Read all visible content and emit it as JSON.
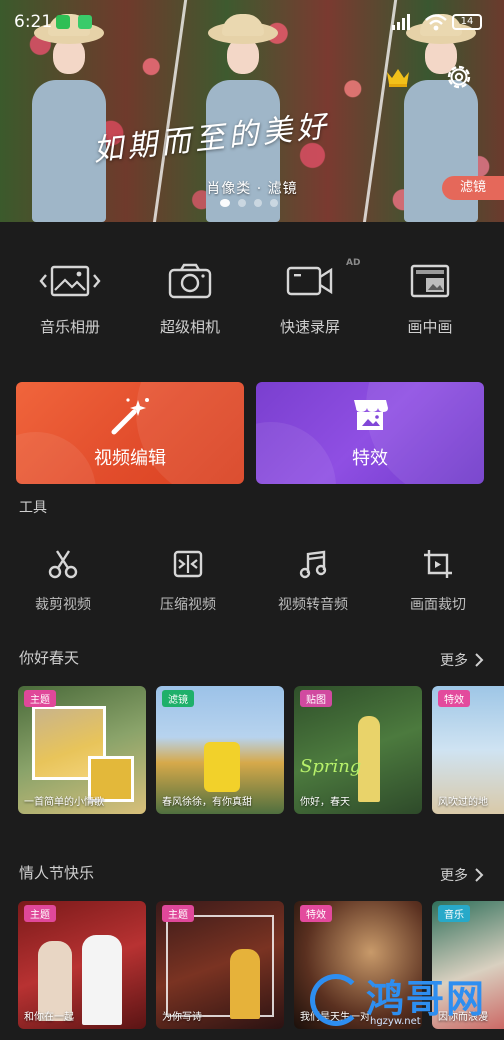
{
  "status": {
    "time": "6:21",
    "battery": "14"
  },
  "banner": {
    "title": "如期而至的美好",
    "subtitle": "肖像类 · 滤镜",
    "tag": "滤镜",
    "page_count": 4,
    "active_page": 1
  },
  "quick_tools": [
    {
      "label": "音乐相册",
      "icon": "photo-album-icon"
    },
    {
      "label": "超级相机",
      "icon": "camera-icon"
    },
    {
      "label": "快速录屏",
      "icon": "screen-record-icon"
    },
    {
      "label": "画中画",
      "icon": "picture-in-picture-icon"
    }
  ],
  "ad_badge": "AD",
  "cards": {
    "edit": {
      "label": "视频编辑",
      "icon": "magic-wand-icon",
      "color": "#e85530"
    },
    "fx": {
      "label": "特效",
      "icon": "store-icon",
      "color": "#8147d8"
    }
  },
  "tools_title": "工具",
  "tools": [
    {
      "label": "裁剪视频",
      "icon": "scissors-icon"
    },
    {
      "label": "压缩视频",
      "icon": "compress-icon"
    },
    {
      "label": "视频转音频",
      "icon": "music-note-icon"
    },
    {
      "label": "画面裁切",
      "icon": "crop-icon"
    }
  ],
  "sections": [
    {
      "title": "你好春天",
      "more": "更多",
      "items": [
        {
          "tag": "主题",
          "tag_type": "theme",
          "caption": "一首简单的小情歌"
        },
        {
          "tag": "滤镜",
          "tag_type": "filter",
          "caption": "春风徐徐，有你真甜"
        },
        {
          "tag": "贴图",
          "tag_type": "sticker",
          "caption": "你好，春天"
        },
        {
          "tag": "特效",
          "tag_type": "effect",
          "caption": "风吹过的地"
        }
      ]
    },
    {
      "title": "情人节快乐",
      "more": "更多",
      "items": [
        {
          "tag": "主题",
          "tag_type": "theme",
          "caption": "和你在一起"
        },
        {
          "tag": "主题",
          "tag_type": "theme",
          "caption": "为你写诗"
        },
        {
          "tag": "特效",
          "tag_type": "effect",
          "caption": "我们是天生一对"
        },
        {
          "tag": "音乐",
          "tag_type": "music",
          "caption": "因你而浪漫"
        }
      ]
    }
  ],
  "watermark": {
    "text": "鸿哥网",
    "url": "hgzyw.net"
  }
}
